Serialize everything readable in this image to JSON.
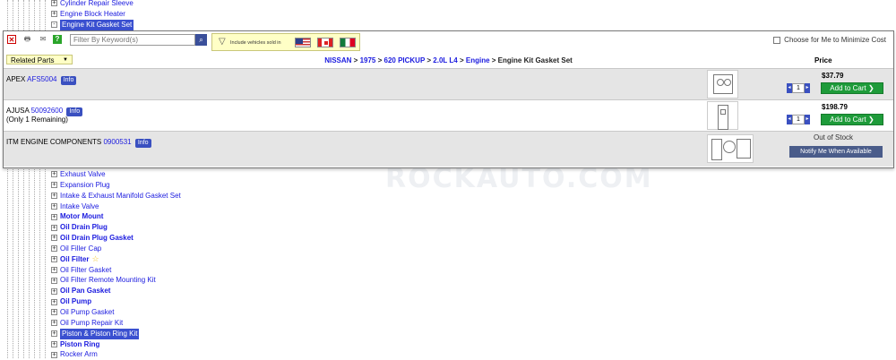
{
  "tree_top": [
    {
      "label": "Cylinder Repair Sleeve",
      "bold": false,
      "hl": false,
      "sign": "+"
    },
    {
      "label": "Engine Block Heater",
      "bold": false,
      "hl": false,
      "sign": "+"
    },
    {
      "label": "Engine Kit Gasket Set",
      "bold": false,
      "hl": true,
      "sign": "-"
    }
  ],
  "tree_bottom": [
    {
      "label": "Exhaust Valve",
      "bold": false,
      "hl": false
    },
    {
      "label": "Expansion Plug",
      "bold": false,
      "hl": false
    },
    {
      "label": "Intake & Exhaust Manifold Gasket Set",
      "bold": false,
      "hl": false
    },
    {
      "label": "Intake Valve",
      "bold": false,
      "hl": false
    },
    {
      "label": "Motor Mount",
      "bold": true,
      "hl": false
    },
    {
      "label": "Oil Drain Plug",
      "bold": true,
      "hl": false
    },
    {
      "label": "Oil Drain Plug Gasket",
      "bold": true,
      "hl": false
    },
    {
      "label": "Oil Filler Cap",
      "bold": false,
      "hl": false
    },
    {
      "label": "Oil Filter",
      "bold": true,
      "hl": false,
      "star": true
    },
    {
      "label": "Oil Filter Gasket",
      "bold": false,
      "hl": false
    },
    {
      "label": "Oil Filter Remote Mounting Kit",
      "bold": false,
      "hl": false
    },
    {
      "label": "Oil Pan Gasket",
      "bold": true,
      "hl": false
    },
    {
      "label": "Oil Pump",
      "bold": true,
      "hl": false
    },
    {
      "label": "Oil Pump Gasket",
      "bold": false,
      "hl": false
    },
    {
      "label": "Oil Pump Repair Kit",
      "bold": false,
      "hl": false
    },
    {
      "label": "Piston & Piston Ring Kit",
      "bold": false,
      "hl": true
    },
    {
      "label": "Piston Ring",
      "bold": true,
      "hl": false
    },
    {
      "label": "Rocker Arm",
      "bold": false,
      "hl": false
    }
  ],
  "toolbar": {
    "keyword_placeholder": "Filter By Keyword(s)",
    "include_text": "Include vehicles sold in",
    "minimize_label": "Choose for Me to Minimize Cost"
  },
  "header": {
    "related_parts": "Related Parts",
    "price_label": "Price",
    "breadcrumb": [
      "NISSAN",
      "1975",
      "620 PICKUP",
      "2.0L L4",
      "Engine"
    ],
    "breadcrumb_current": "Engine Kit Gasket Set",
    "separator": ">"
  },
  "products": [
    {
      "brand": "APEX",
      "part_no": "AFS5004",
      "info": "Info",
      "note": "",
      "price": "$37.79",
      "qty": "1",
      "action": "Add to Cart",
      "in_stock": true
    },
    {
      "brand": "AJUSA",
      "part_no": "50092600",
      "info": "Info",
      "note": "(Only 1 Remaining)",
      "price": "$198.79",
      "qty": "1",
      "action": "Add to Cart",
      "in_stock": true
    },
    {
      "brand": "ITM ENGINE COMPONENTS",
      "part_no": "0900531",
      "info": "Info",
      "note": "",
      "price": "Out of Stock",
      "qty": "",
      "action": "Notify Me When Available",
      "in_stock": false
    }
  ],
  "watermark": "ROCKAUTO.COM",
  "colors": {
    "link": "#1a1adf",
    "highlight": "#3a50d0",
    "cart_green": "#1e9b3a",
    "notify": "#4a5c8a",
    "info": "#3a50c0"
  }
}
